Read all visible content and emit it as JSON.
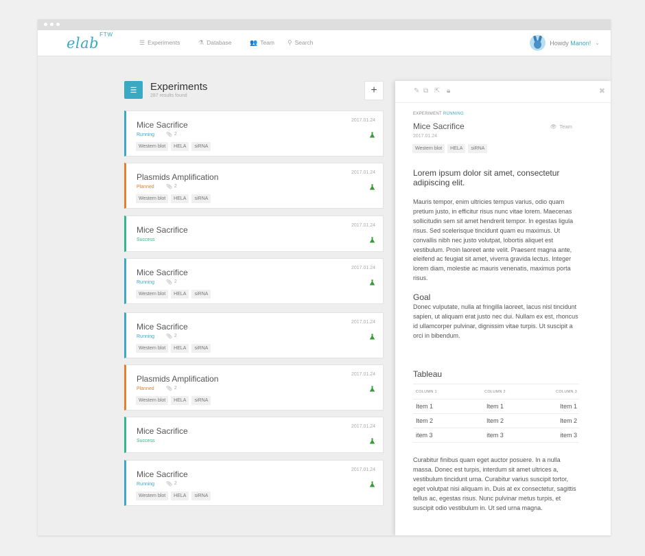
{
  "app": {
    "logo_text": "elab",
    "logo_sup": "FTW"
  },
  "nav": [
    {
      "label": "Experiments",
      "icon": "list-icon"
    },
    {
      "label": "Database",
      "icon": "flask-icon"
    },
    {
      "label": "Team",
      "icon": "team-icon"
    },
    {
      "label": "Search",
      "icon": "search-icon"
    }
  ],
  "user": {
    "greeting": "Howdy",
    "name": "Manon",
    "suffix": "!"
  },
  "list": {
    "title": "Experiments",
    "count_text": "287 results found",
    "add_label": "+"
  },
  "experiments": [
    {
      "title": "Mice Sacrifice",
      "status": "Running",
      "attachments": "2",
      "date": "2017.01.24",
      "tags": [
        "Western blot",
        "HELA",
        "siRNA"
      ]
    },
    {
      "title": "Plasmids Amplification",
      "status": "Planned",
      "attachments": "2",
      "date": "2017.01.24",
      "tags": [
        "Western blot",
        "HELA",
        "siRNA"
      ]
    },
    {
      "title": "Mice Sacrifice",
      "status": "Success",
      "date": "2017.01.24"
    },
    {
      "title": "Mice Sacrifice",
      "status": "Running",
      "attachments": "2",
      "date": "2017.01.24",
      "tags": [
        "Western blot",
        "HELA",
        "siRNA"
      ]
    },
    {
      "title": "Mice Sacrifice",
      "status": "Running",
      "attachments": "2",
      "date": "2017.01.24",
      "tags": [
        "Western blot",
        "HELA",
        "siRNA"
      ]
    },
    {
      "title": "Plasmids Amplification",
      "status": "Planned",
      "attachments": "2",
      "date": "2017.01.24",
      "tags": [
        "Western blot",
        "HELA",
        "siRNA"
      ]
    },
    {
      "title": "Mice Sacrifice",
      "status": "Success",
      "date": "2017.01.24"
    },
    {
      "title": "Mice Sacrifice",
      "status": "Running",
      "attachments": "2",
      "date": "2017.01.24",
      "tags": [
        "Western blot",
        "HELA",
        "siRNA"
      ]
    }
  ],
  "detail": {
    "kicker": "EXPERIMENT",
    "kicker_status": "RUNNING",
    "title": "Mice Sacrifice",
    "visibility": "Team",
    "date": "2017.01.24",
    "tags": [
      "Western blot",
      "HELA",
      "siRNA"
    ],
    "heading": "Lorem ipsum dolor sit amet, consectetur adipiscing elit.",
    "intro": "Mauris tempor, enim ultricies tempus varius, odio quam pretium justo, in efficitur risus nunc vitae lorem. Maecenas sollicitudin sem sit amet hendrerit tempor. In egestas ligula risus. Sed scelerisque tincidunt quam eu maximus. Ut convallis nibh nec justo volutpat, lobortis aliquet est vestibulum. Proin laoreet ante velit. Praesent magna ante, eleifend ac feugiat sit amet, viverra gravida lectus. Integer lorem diam, molestie ac mauris venenatis, maximus porta risus.",
    "goal_title": "Goal",
    "goal_text": "Donec vulputate, nulla at fringilla laoreet, lacus nisl tincidunt sapien, ut aliquam erat justo nec dui. Nullam ex est, rhoncus id ullamcorper pulvinar, dignissim vitae turpis. Ut suscipit a orci in bibendum.",
    "table_title": "Tableau",
    "table_headers": [
      "COLUMN 1",
      "COLUMN 2",
      "COLUMN 3"
    ],
    "table_rows": [
      [
        "Item 1",
        "Item 1",
        "Item 1"
      ],
      [
        "Item 2",
        "Item 2",
        "Item 2"
      ],
      [
        "item 3",
        "item 3",
        "item 3"
      ]
    ],
    "outro": "Curabitur finibus quam eget auctor posuere. In a nulla massa. Donec est turpis, interdum sit amet ultrices a, vestibulum tincidunt urna. Curabitur varius suscipit tortor, eget volutpat nisi aliquam in. Duis at ex consectetur, sagittis tellus ac, egestas risus. Nunc pulvinar metus turpis, et suscipit odio vestibulum in. Ut sed urna magna."
  },
  "colors": {
    "accent": "#3aa9c4",
    "planned": "#e87e2a",
    "success": "#2fb98a",
    "flask": "#3a9a3a"
  }
}
